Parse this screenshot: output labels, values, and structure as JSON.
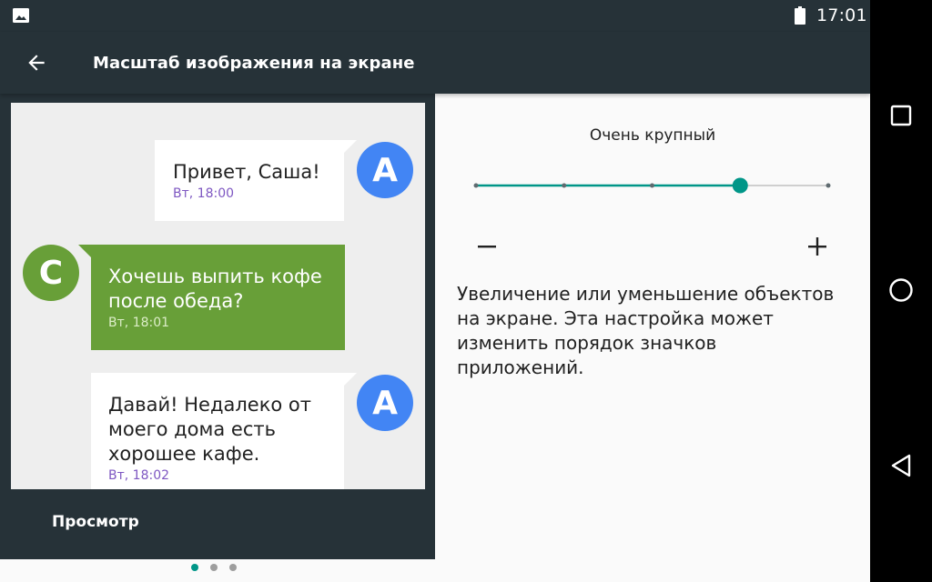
{
  "status_bar": {
    "time": "17:01",
    "notification_icon": "image-icon",
    "battery_icon": "battery-icon"
  },
  "app_bar": {
    "title": "Масштаб изображения на экране",
    "back_icon": "arrow-back-icon"
  },
  "preview": {
    "label": "Просмотр",
    "messages": [
      {
        "side": "in",
        "avatar": "A",
        "text": "Привет, Саша!",
        "time": "Вт, 18:00"
      },
      {
        "side": "out",
        "avatar": "C",
        "text": "Хочешь выпить кофе после обеда?",
        "time": "Вт, 18:01"
      },
      {
        "side": "in",
        "avatar": "A",
        "text": "Давай! Недалеко от моего дома есть хорошее кафе.",
        "time": "Вт, 18:02"
      }
    ]
  },
  "settings": {
    "size_label": "Очень крупный",
    "slider": {
      "steps": 5,
      "selected_index": 3
    },
    "decrease_icon": "minus-icon",
    "increase_icon": "plus-icon",
    "description": "Увеличение или уменьшение объектов на экране. Эта настройка может изменить порядок значков приложений."
  },
  "page_indicator": {
    "count": 3,
    "active": 0
  },
  "colors": {
    "app_bar": "#263238",
    "accent": "#009688",
    "incoming_time": "#7e57c2",
    "outgoing_bubble": "#689f38",
    "avatar_blue": "#4285f4"
  },
  "nav_bar": {
    "recents_icon": "square-recents-icon",
    "home_icon": "circle-home-icon",
    "back_icon": "triangle-back-icon"
  }
}
